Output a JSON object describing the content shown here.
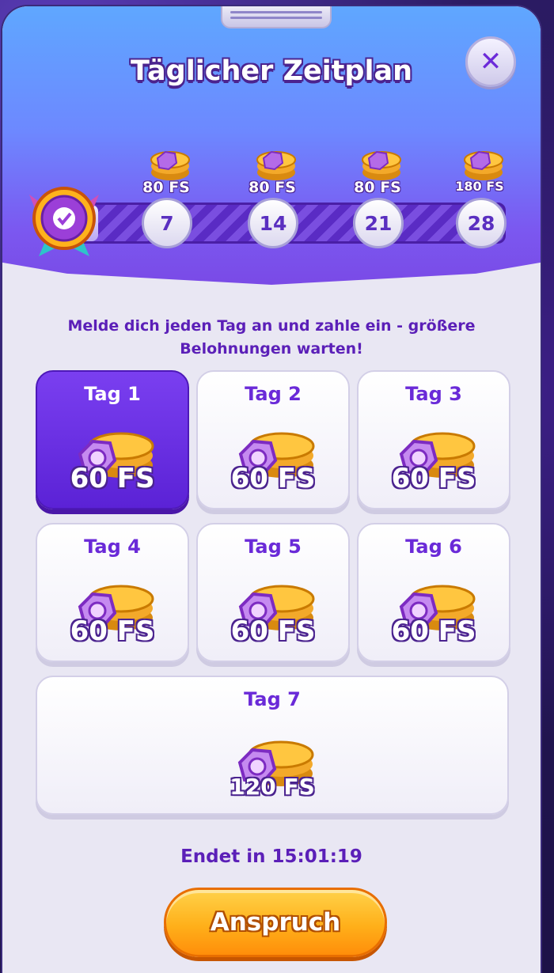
{
  "header": {
    "title": "Täglicher Zeitplan"
  },
  "progress": {
    "milestones": [
      {
        "day": "7",
        "reward": "80 FS"
      },
      {
        "day": "14",
        "reward": "80 FS"
      },
      {
        "day": "21",
        "reward": "80 FS"
      },
      {
        "day": "28",
        "reward": "180 FS"
      }
    ]
  },
  "description": "Melde dich jeden Tag an und zahle ein - größere Belohnungen warten!",
  "days": [
    {
      "label": "Tag 1",
      "reward": "60 FS"
    },
    {
      "label": "Tag 2",
      "reward": "60 FS"
    },
    {
      "label": "Tag 3",
      "reward": "60 FS"
    },
    {
      "label": "Tag 4",
      "reward": "60 FS"
    },
    {
      "label": "Tag 5",
      "reward": "60 FS"
    },
    {
      "label": "Tag 6",
      "reward": "60 FS"
    },
    {
      "label": "Tag 7",
      "reward": "120 FS"
    }
  ],
  "timer": "Endet in 15:01:19",
  "claim_label": "Anspruch",
  "colors": {
    "accent": "#6a2ad8",
    "button": "#ffb01a",
    "header": "#6d88ff"
  }
}
